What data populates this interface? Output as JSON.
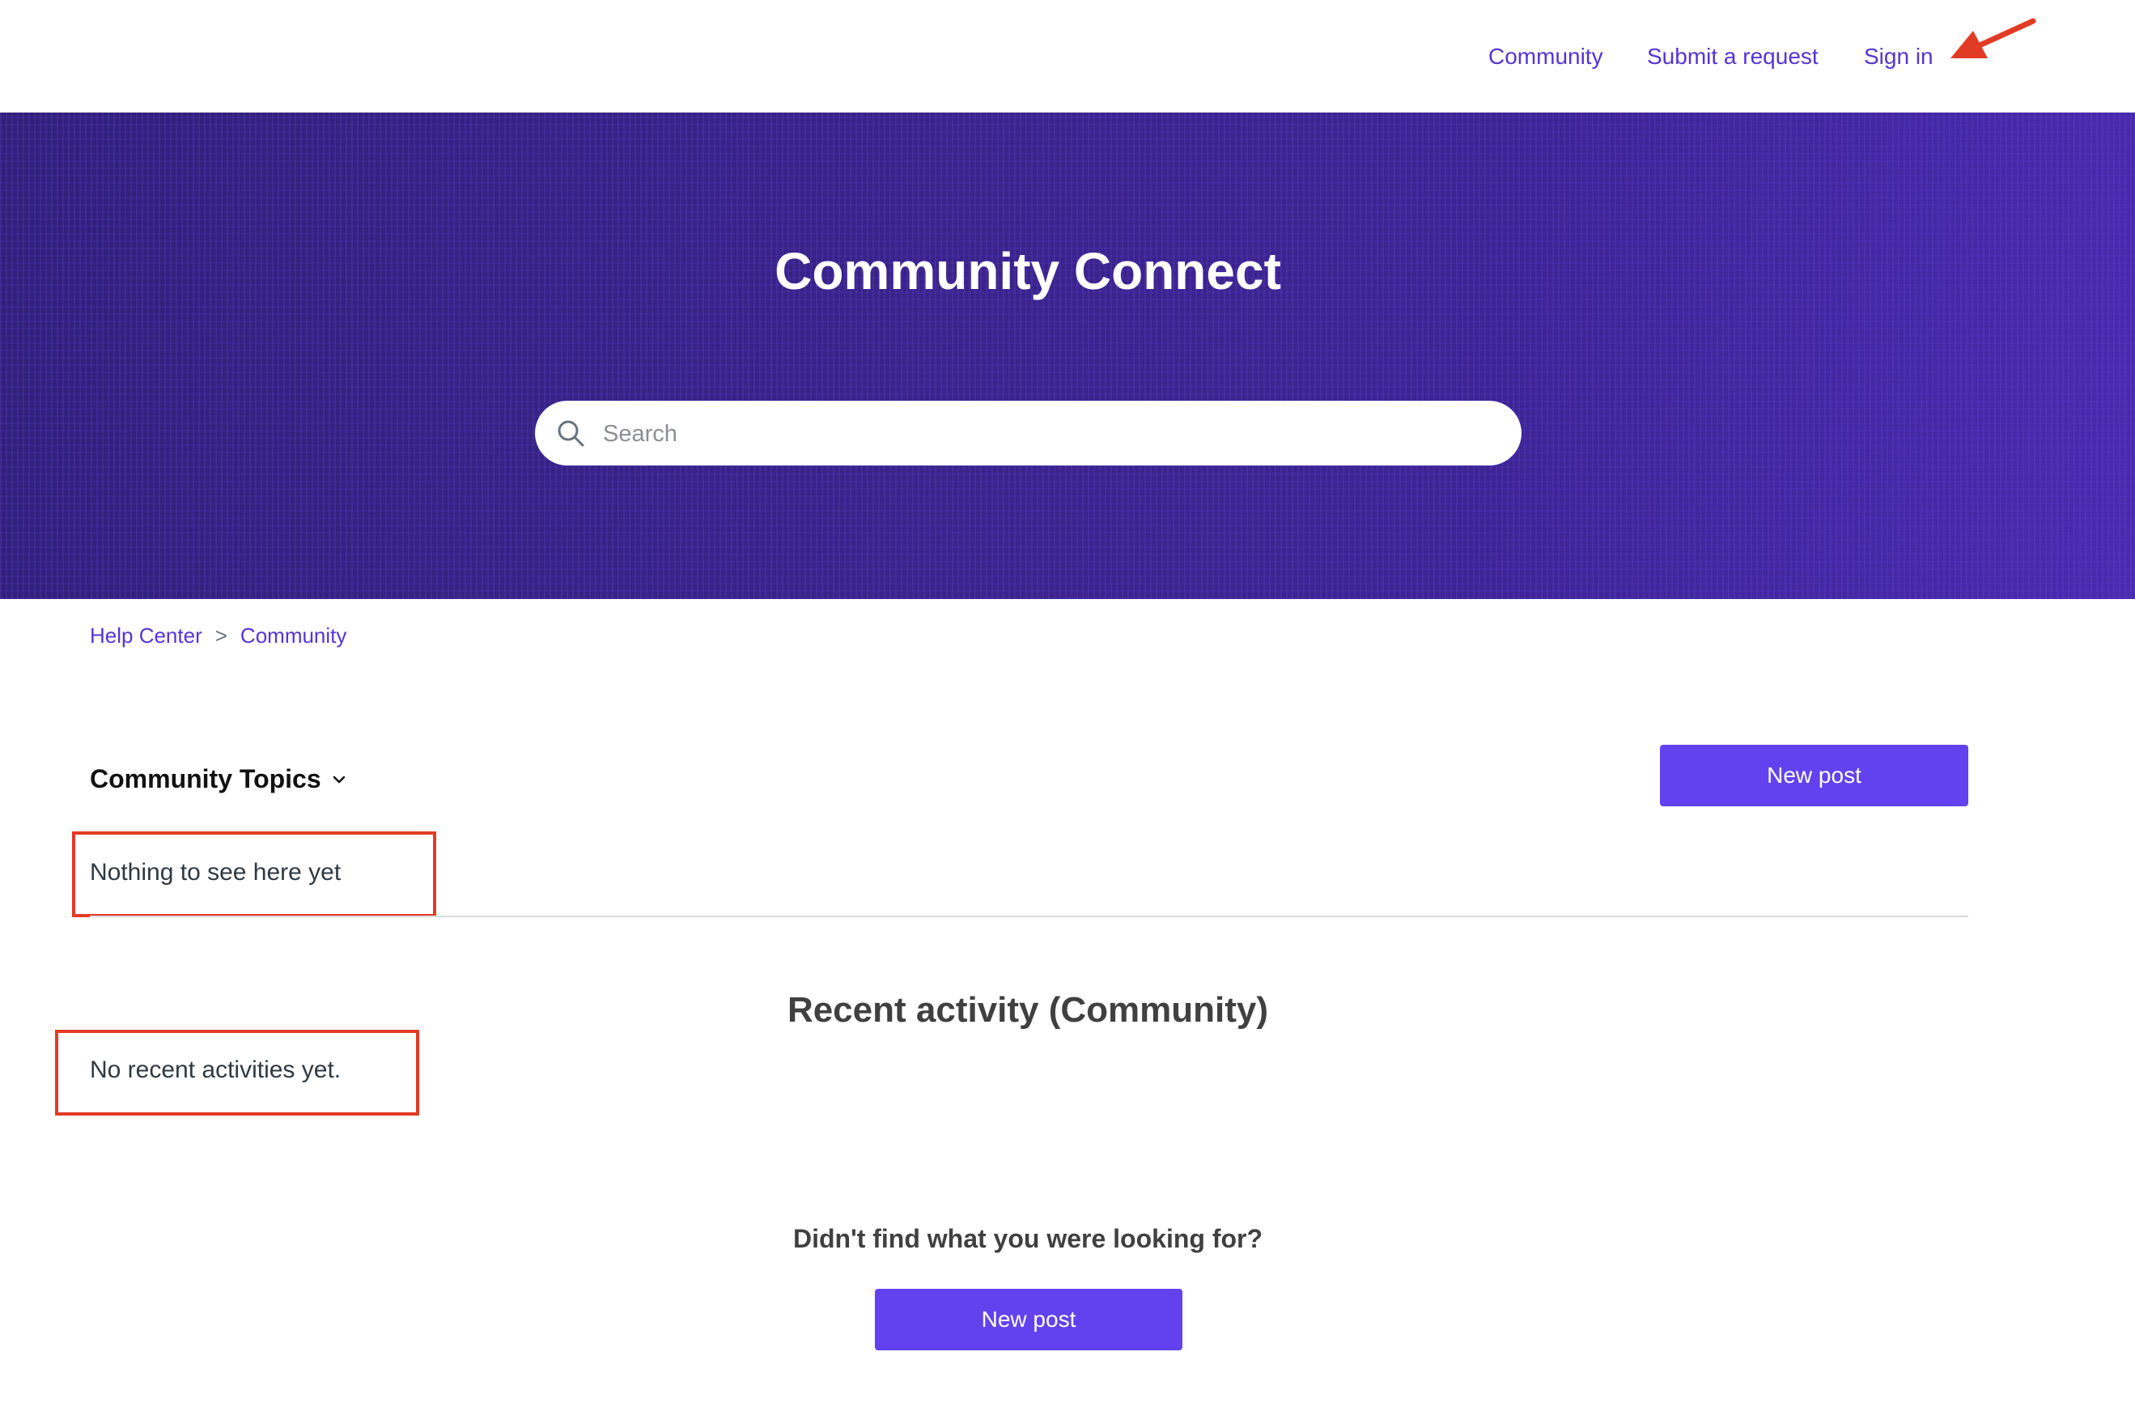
{
  "header": {
    "nav": {
      "community": "Community",
      "submit_request": "Submit a request",
      "sign_in": "Sign in"
    }
  },
  "hero": {
    "title": "Community Connect",
    "search": {
      "placeholder": "Search",
      "value": ""
    }
  },
  "breadcrumb": {
    "items": [
      "Help Center",
      "Community"
    ],
    "separator": ">"
  },
  "topics": {
    "title": "Community Topics",
    "new_post_label": "New post",
    "empty_text": "Nothing to see here yet"
  },
  "recent_activity": {
    "title": "Recent activity (Community)",
    "empty_text": "No recent activities yet."
  },
  "footer_prompt": {
    "text": "Didn't find what you were looking for?",
    "new_post_label": "New post"
  },
  "colors": {
    "accent": "#5534d3",
    "button": "#6142ee",
    "hero_background": "#35207e",
    "annotation": "#e23b25"
  },
  "icons": [
    "search-icon",
    "chevron-down-icon",
    "annotation-arrow-icon"
  ]
}
